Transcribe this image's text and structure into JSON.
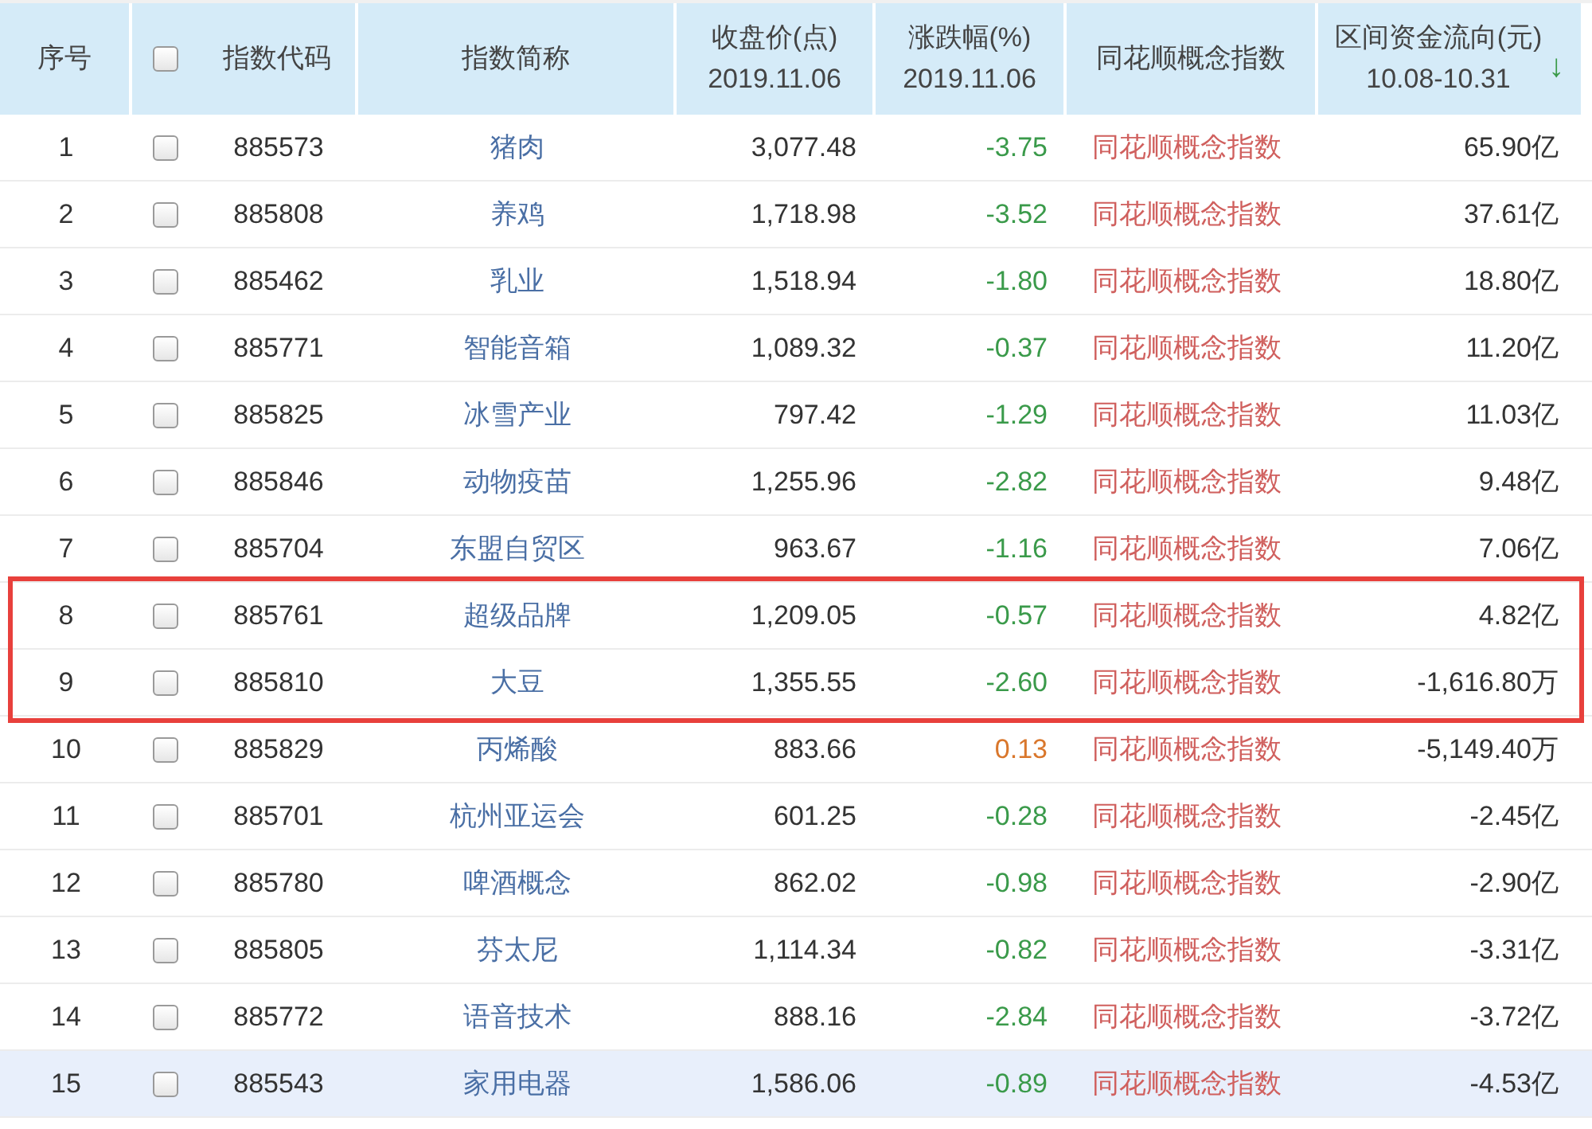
{
  "header": {
    "index": "序号",
    "checkbox_checked": false,
    "code": "指数代码",
    "name": "指数简称",
    "price": [
      "收盘价(点)",
      "2019.11.06"
    ],
    "change": [
      "涨跌幅(%)",
      "2019.11.06"
    ],
    "concept": "同花顺概念指数",
    "flow": [
      "区间资金流向(元)",
      "10.08-10.31"
    ],
    "sort_arrow": "↓"
  },
  "rows": [
    {
      "index": "1",
      "checked": false,
      "code": "885573",
      "name": "猪肉",
      "price": "3,077.48",
      "change": "-3.75",
      "kind": "down",
      "concept": "同花顺概念指数",
      "flow": "65.90亿",
      "highlighted": false,
      "selected": false
    },
    {
      "index": "2",
      "checked": false,
      "code": "885808",
      "name": "养鸡",
      "price": "1,718.98",
      "change": "-3.52",
      "kind": "down",
      "concept": "同花顺概念指数",
      "flow": "37.61亿",
      "highlighted": false,
      "selected": false
    },
    {
      "index": "3",
      "checked": false,
      "code": "885462",
      "name": "乳业",
      "price": "1,518.94",
      "change": "-1.80",
      "kind": "down",
      "concept": "同花顺概念指数",
      "flow": "18.80亿",
      "highlighted": false,
      "selected": false
    },
    {
      "index": "4",
      "checked": false,
      "code": "885771",
      "name": "智能音箱",
      "price": "1,089.32",
      "change": "-0.37",
      "kind": "down",
      "concept": "同花顺概念指数",
      "flow": "11.20亿",
      "highlighted": false,
      "selected": false
    },
    {
      "index": "5",
      "checked": false,
      "code": "885825",
      "name": "冰雪产业",
      "price": "797.42",
      "change": "-1.29",
      "kind": "down",
      "concept": "同花顺概念指数",
      "flow": "11.03亿",
      "highlighted": false,
      "selected": false
    },
    {
      "index": "6",
      "checked": false,
      "code": "885846",
      "name": "动物疫苗",
      "price": "1,255.96",
      "change": "-2.82",
      "kind": "down",
      "concept": "同花顺概念指数",
      "flow": "9.48亿",
      "highlighted": false,
      "selected": false
    },
    {
      "index": "7",
      "checked": false,
      "code": "885704",
      "name": "东盟自贸区",
      "price": "963.67",
      "change": "-1.16",
      "kind": "down",
      "concept": "同花顺概念指数",
      "flow": "7.06亿",
      "highlighted": false,
      "selected": false
    },
    {
      "index": "8",
      "checked": false,
      "code": "885761",
      "name": "超级品牌",
      "price": "1,209.05",
      "change": "-0.57",
      "kind": "down",
      "concept": "同花顺概念指数",
      "flow": "4.82亿",
      "highlighted": true,
      "selected": false
    },
    {
      "index": "9",
      "checked": false,
      "code": "885810",
      "name": "大豆",
      "price": "1,355.55",
      "change": "-2.60",
      "kind": "down",
      "concept": "同花顺概念指数",
      "flow": "-1,616.80万",
      "highlighted": true,
      "selected": false
    },
    {
      "index": "10",
      "checked": false,
      "code": "885829",
      "name": "丙烯酸",
      "price": "883.66",
      "change": "0.13",
      "kind": "up",
      "concept": "同花顺概念指数",
      "flow": "-5,149.40万",
      "highlighted": false,
      "selected": false
    },
    {
      "index": "11",
      "checked": false,
      "code": "885701",
      "name": "杭州亚运会",
      "price": "601.25",
      "change": "-0.28",
      "kind": "down",
      "concept": "同花顺概念指数",
      "flow": "-2.45亿",
      "highlighted": false,
      "selected": false
    },
    {
      "index": "12",
      "checked": false,
      "code": "885780",
      "name": "啤酒概念",
      "price": "862.02",
      "change": "-0.98",
      "kind": "down",
      "concept": "同花顺概念指数",
      "flow": "-2.90亿",
      "highlighted": false,
      "selected": false
    },
    {
      "index": "13",
      "checked": false,
      "code": "885805",
      "name": "芬太尼",
      "price": "1,114.34",
      "change": "-0.82",
      "kind": "down",
      "concept": "同花顺概念指数",
      "flow": "-3.31亿",
      "highlighted": false,
      "selected": false
    },
    {
      "index": "14",
      "checked": false,
      "code": "885772",
      "name": "语音技术",
      "price": "888.16",
      "change": "-2.84",
      "kind": "down",
      "concept": "同花顺概念指数",
      "flow": "-3.72亿",
      "highlighted": false,
      "selected": false
    },
    {
      "index": "15",
      "checked": false,
      "code": "885543",
      "name": "家用电器",
      "price": "1,586.06",
      "change": "-0.89",
      "kind": "down",
      "concept": "同花顺概念指数",
      "flow": "-4.53亿",
      "highlighted": false,
      "selected": true
    }
  ]
}
